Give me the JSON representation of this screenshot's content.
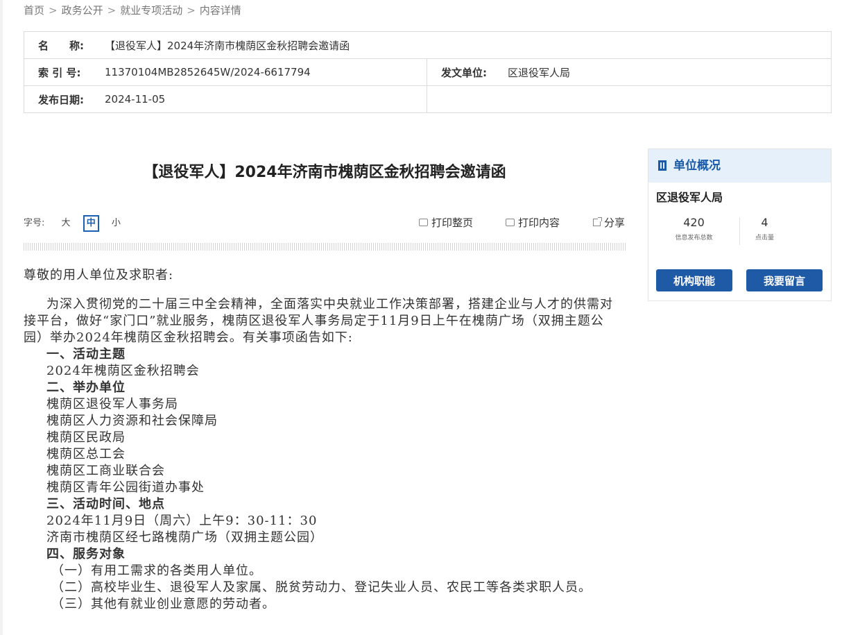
{
  "breadcrumb": [
    "首页",
    "政务公开",
    "就业专项活动",
    "内容详情"
  ],
  "meta": {
    "name_label": "名　　称:",
    "name_value": "【退役军人】2024年济南市槐荫区金秋招聘会邀请函",
    "index_label": "索 引 号:",
    "index_value": "11370104MB2852645W/2024-6617794",
    "issuer_label": "发文单位:",
    "issuer_value": "区退役军人局",
    "date_label": "发布日期:",
    "date_value": "2024-11-05"
  },
  "article": {
    "title": "【退役军人】2024年济南市槐荫区金秋招聘会邀请函",
    "body": {
      "greeting": "尊敬的用人单位及求职者:",
      "intro": "为深入贯彻党的二十届三中全会精神，全面落实中央就业工作决策部署，搭建企业与人才的供需对接平台，做好“家门口”就业服务，槐荫区退役军人事务局定于11月9日上午在槐荫广场（双拥主题公园）举办2024年槐荫区金秋招聘会。有关事项函告如下:",
      "s1": "一、活动主题",
      "s1_text": "2024年槐荫区金秋招聘会",
      "s2": "二、举办单位",
      "orgs": [
        "槐荫区退役军人事务局",
        "槐荫区人力资源和社会保障局",
        "槐荫区民政局",
        "槐荫区总工会",
        "槐荫区工商业联合会",
        "槐荫区青年公园街道办事处"
      ],
      "s3": "三、活动时间、地点",
      "time": "2024年11月9日（周六）上午9：30-11：30",
      "place": "济南市槐荫区经七路槐荫广场（双拥主题公园）",
      "s4": "四、服务对象",
      "targets": [
        "（一）有用工需求的各类用人单位。",
        "（二）高校毕业生、退役军人及家属、脱贫劳动力、登记失业人员、农民工等各类求职人员。",
        "（三）其他有就业创业意愿的劳动者。"
      ]
    }
  },
  "font_size": {
    "label": "字号:",
    "large": "大",
    "medium": "中",
    "small": "小"
  },
  "tools": {
    "print_page": "打印整页",
    "print_content": "打印内容",
    "share": "分享"
  },
  "sidebar": {
    "title": "单位概况",
    "org": "区退役军人局",
    "stat1_value": "420",
    "stat1_label": "信息发布总数",
    "stat2_value": "4",
    "stat2_label": "点击量",
    "btn_functions": "机构职能",
    "btn_message": "我要留言"
  },
  "colors": {
    "accent": "#1f5aa6",
    "sidebar_header_bg": "#e6f0fb"
  }
}
